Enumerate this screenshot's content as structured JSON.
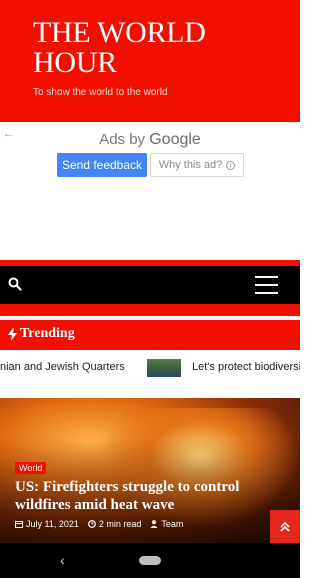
{
  "header": {
    "site_title": "THE WORLD HOUR",
    "tagline": "To show the world to the world"
  },
  "ad": {
    "back_arrow": "←",
    "ads_by": "Ads by",
    "google": "Google",
    "feedback_button": "Send feedback",
    "why_button": "Why this ad?",
    "info_glyph": "i"
  },
  "nav": {
    "search_icon": "search-icon",
    "menu_icon": "hamburger-menu-icon"
  },
  "trending": {
    "label": "Trending",
    "icon": "bolt-icon",
    "items": [
      {
        "text": "nian and Jewish Quarters"
      },
      {
        "text": "Let's protect biodiversit"
      }
    ]
  },
  "featured": {
    "category": "World",
    "title": "US: Firefighters struggle to control wildfires amid heat wave",
    "date": "July 11, 2021",
    "read_time": "2 min read",
    "author": "Team"
  },
  "system_nav": {
    "back_glyph": "‹"
  },
  "colors": {
    "brand_red": "#f20f00",
    "google_blue": "#4285f4",
    "nav_black": "#000000"
  }
}
